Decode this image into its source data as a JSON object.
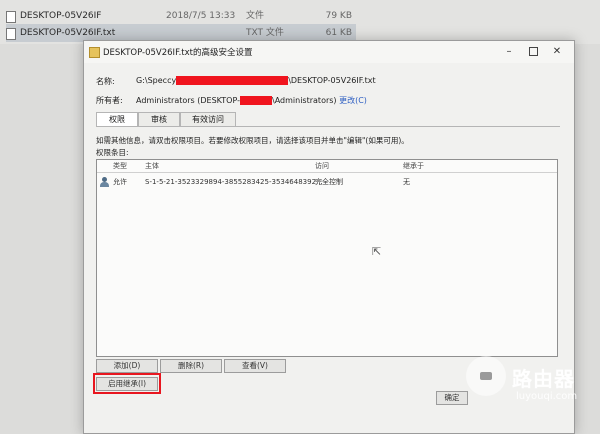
{
  "explorer": {
    "files": [
      {
        "name": "DESKTOP-05V26IF",
        "date": "2018/7/5 13:33",
        "type": "文件",
        "size": "79 KB"
      },
      {
        "name": "DESKTOP-05V26IF.txt",
        "date": "",
        "type": "TXT 文件",
        "size": "61 KB"
      }
    ]
  },
  "dialog": {
    "title": "DESKTOP-05V26IF.txt的高级安全设置",
    "name_label": "名称:",
    "name_prefix": "G:\\Speccy",
    "name_suffix": "\\DESKTOP-05V26IF.txt",
    "owner_label": "所有者:",
    "owner_prefix": "Administrators (DESKTOP-",
    "owner_suffix": "\\Administrators)",
    "owner_change_link": "更改(C)",
    "tabs": [
      "权限",
      "审核",
      "有效访问"
    ],
    "info_text": "如需其他信息，请双击权限项目。若要修改权限项目，请选择该项目并单击\"编辑\"(如果可用)。",
    "entries_label": "权限条目:",
    "columns": [
      "类型",
      "主体",
      "访问",
      "继承于"
    ],
    "rows": [
      {
        "type": "允许",
        "principal": "S-1-5-21-3523329894-3855283425-3534648392...",
        "access": "完全控制",
        "inherited": "无"
      }
    ],
    "buttons": {
      "add": "添加(D)",
      "remove": "删除(R)",
      "view": "查看(V)",
      "enable_inheritance": "启用继承(I)",
      "ok": "确定"
    },
    "accent_color": "#e8161f"
  },
  "watermark": {
    "cn": "路由器",
    "en": "luyouqi.com"
  }
}
